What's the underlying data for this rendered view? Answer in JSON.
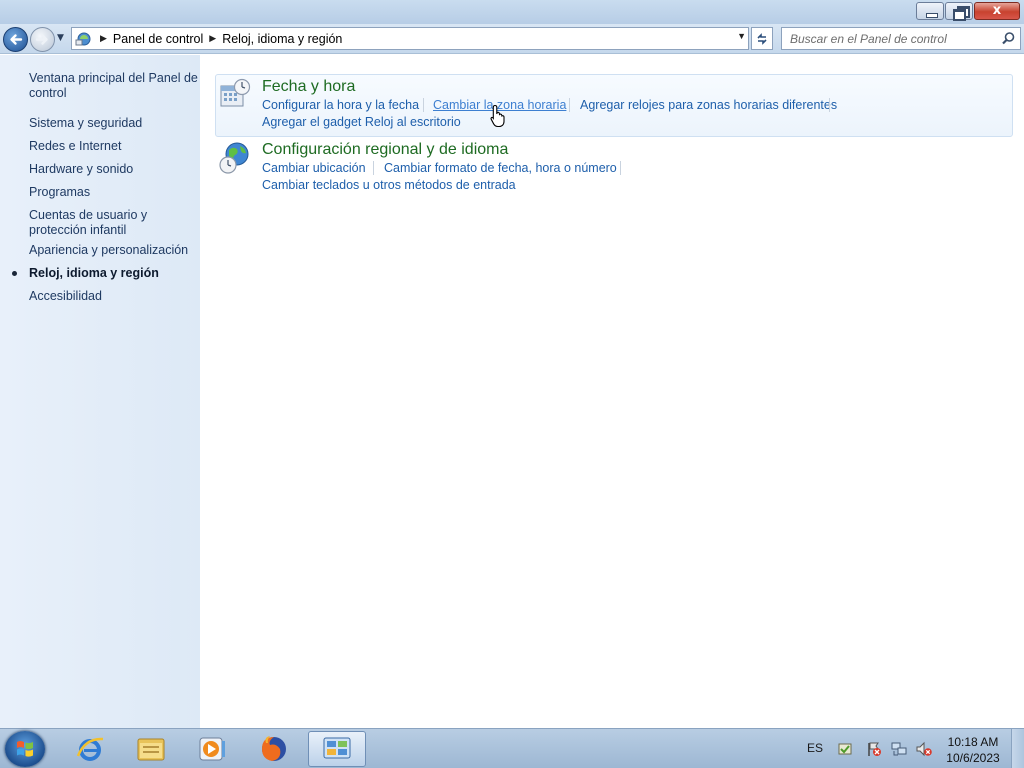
{
  "window": {
    "minimize_label": "",
    "maximize_label": "",
    "close_label": "x"
  },
  "nav": {
    "breadcrumb": [
      "Panel de control",
      "Reloj, idioma y región"
    ],
    "search_placeholder": "Buscar en el Panel de control"
  },
  "sidebar": {
    "items": [
      {
        "label": "Ventana principal del Panel de control",
        "current": false
      },
      {
        "label": "Sistema y seguridad",
        "current": false
      },
      {
        "label": "Redes e Internet",
        "current": false
      },
      {
        "label": "Hardware y sonido",
        "current": false
      },
      {
        "label": "Programas",
        "current": false
      },
      {
        "label": "Cuentas de usuario y protección infantil",
        "current": false
      },
      {
        "label": "Apariencia y personalización",
        "current": false
      },
      {
        "label": "Reloj, idioma y región",
        "current": true
      },
      {
        "label": "Accesibilidad",
        "current": false
      }
    ]
  },
  "categories": [
    {
      "title": "Fecha y hora",
      "icon": "calendar-clock-icon",
      "links": [
        "Configurar la hora y la fecha",
        "Cambiar la zona horaria",
        "Agregar relojes para zonas horarias diferentes",
        "Agregar el gadget Reloj al escritorio"
      ],
      "hovered_link": "Cambiar la zona horaria"
    },
    {
      "title": "Configuración regional y de idioma",
      "icon": "globe-clock-icon",
      "links": [
        "Cambiar ubicación",
        "Cambiar formato de fecha, hora o número",
        "Cambiar teclados u otros métodos de entrada"
      ]
    }
  ],
  "taskbar": {
    "apps": [
      "internet-explorer-icon",
      "windows-explorer-icon",
      "media-player-icon",
      "firefox-icon",
      "control-panel-icon"
    ],
    "active_app": "control-panel-icon",
    "language": "ES",
    "time": "10:18 AM",
    "date": "10/6/2023"
  },
  "colors": {
    "link": "#1e5fab",
    "category_title": "#1e6b22",
    "sidebar_bg": "#e3edf8"
  }
}
